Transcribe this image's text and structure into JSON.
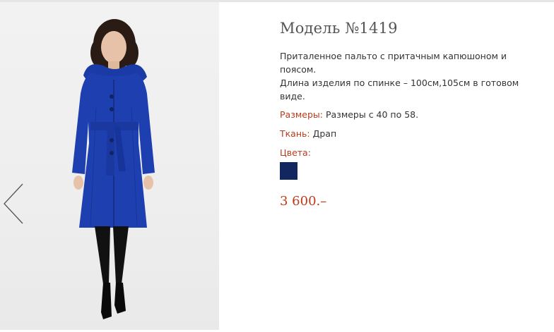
{
  "product": {
    "title": "Модель №1419",
    "description_line1": "Приталенное пальто с притачным капюшоном и поясом.",
    "description_line2": "Длина изделия по спинке – 100см,105см в готовом виде.",
    "sizes_label": "Размеры:",
    "sizes_value": "Размеры с 40 по 58.",
    "fabric_label": "Ткань:",
    "fabric_value": "Драп",
    "colors_label": "Цвета:",
    "price": "3 600.–"
  },
  "gallery": {
    "prev_icon": "chevron-left-icon",
    "photo": "model-in-blue-coat"
  },
  "colors": {
    "accent_label": "#b83a1b",
    "price": "#c0391b",
    "swatch": "#12275f",
    "coat": "#1d3fb0"
  }
}
